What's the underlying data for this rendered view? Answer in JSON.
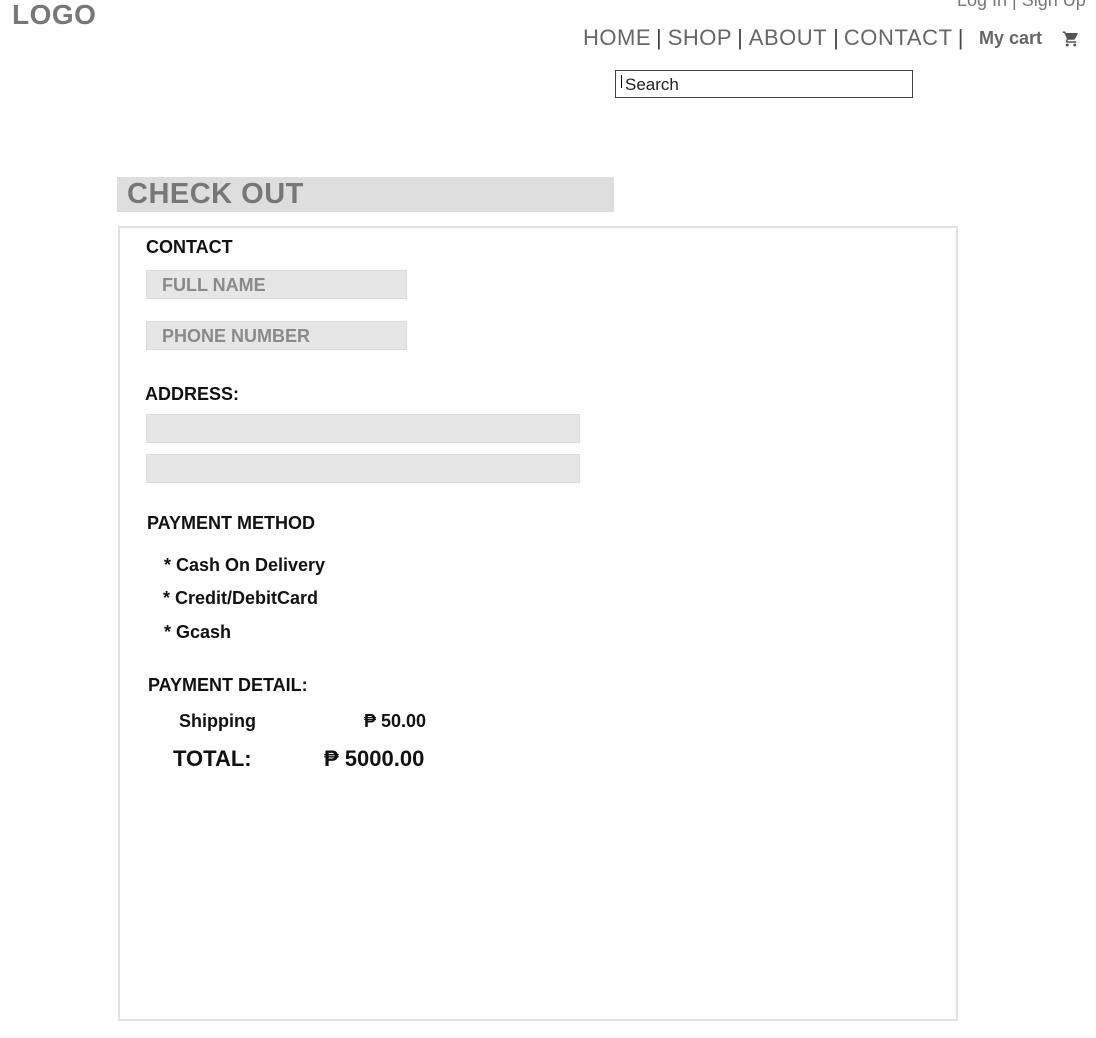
{
  "header": {
    "logo": "LOGO",
    "auth": {
      "login": "Log In",
      "separator": "|",
      "signup": "Sign Up"
    },
    "nav": [
      {
        "label": "HOME"
      },
      {
        "label": "SHOP"
      },
      {
        "label": "ABOUT"
      },
      {
        "label": "CONTACT"
      }
    ],
    "nav_separator": "|",
    "cart_label": "My cart",
    "cart_icon": "shopping-cart-icon",
    "search": {
      "placeholder": "Search",
      "value": ""
    }
  },
  "checkout": {
    "title": "CHECK OUT",
    "contact_label": "CONTACT",
    "full_name_placeholder": "FULL NAME",
    "phone_placeholder": "PHONE NUMBER",
    "address_label": "ADDRESS:",
    "payment_method_label": "PAYMENT METHOD",
    "payment_methods": [
      "* Cash On Delivery",
      "* Credit/DebitCard",
      "* Gcash"
    ],
    "payment_detail_label": "PAYMENT DETAIL:",
    "shipping_label": "Shipping",
    "shipping_value": "₱ 50.00",
    "total_label": "TOTAL:",
    "total_value": "₱ 5000.00"
  },
  "colors": {
    "muted_text": "#777777",
    "field_bg": "#e6e6e6",
    "title_bar_bg": "#dedede"
  }
}
